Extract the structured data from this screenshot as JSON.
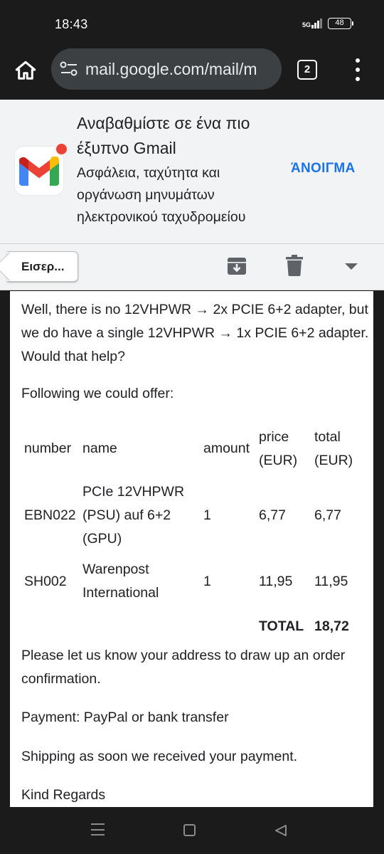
{
  "status_bar": {
    "time": "18:43",
    "network": "5G",
    "battery": "48"
  },
  "browser": {
    "url": "mail.google.com/mail/m",
    "tab_count": "2",
    "icons": [
      "home-icon",
      "site-settings-icon",
      "tabs-icon",
      "more-vert-icon"
    ]
  },
  "promo": {
    "title": "Αναβαθμίστε σε ένα πιο έξυπνο Gmail",
    "subtitle": "Ασφάλεια, ταχύτητα και οργάνωση μηνυμάτων ηλεκτρονικού ταχυδρομείου",
    "open_label": "ΆΝΟΙΓΜΑ",
    "accent_color": "#1a73e8"
  },
  "toolbar": {
    "back_label": "Εισερ...",
    "icons": [
      "archive-icon",
      "delete-icon",
      "dropdown-arrow-icon"
    ]
  },
  "message": {
    "intro": "Well, there is no 12VHPWR → 2x PCIE 6+2 adapter, but we do have a single 12VHPWR → 1x PCIE 6+2 adapter. Would that help?",
    "offer": "Following we could offer:",
    "table": {
      "headers": {
        "number": "number",
        "name": "name",
        "amount": "amount",
        "price": "price (EUR)",
        "total": "total (EUR)"
      },
      "rows": [
        {
          "number": "EBN022",
          "name": "PCIe 12VHPWR (PSU) auf 6+2 (GPU)",
          "amount": "1",
          "price": "6,77",
          "total": "6,77"
        },
        {
          "number": "SH002",
          "name": "Warenpost International",
          "amount": "1",
          "price": "11,95",
          "total": "11,95"
        }
      ],
      "total_label": "TOTAL",
      "total_value": "18,72"
    },
    "address_request": "Please let us know your address to draw up an order confirmation.",
    "payment": "Payment: PayPal or bank transfer",
    "shipping": "Shipping as soon we received your payment.",
    "regards": "Kind Regards"
  }
}
